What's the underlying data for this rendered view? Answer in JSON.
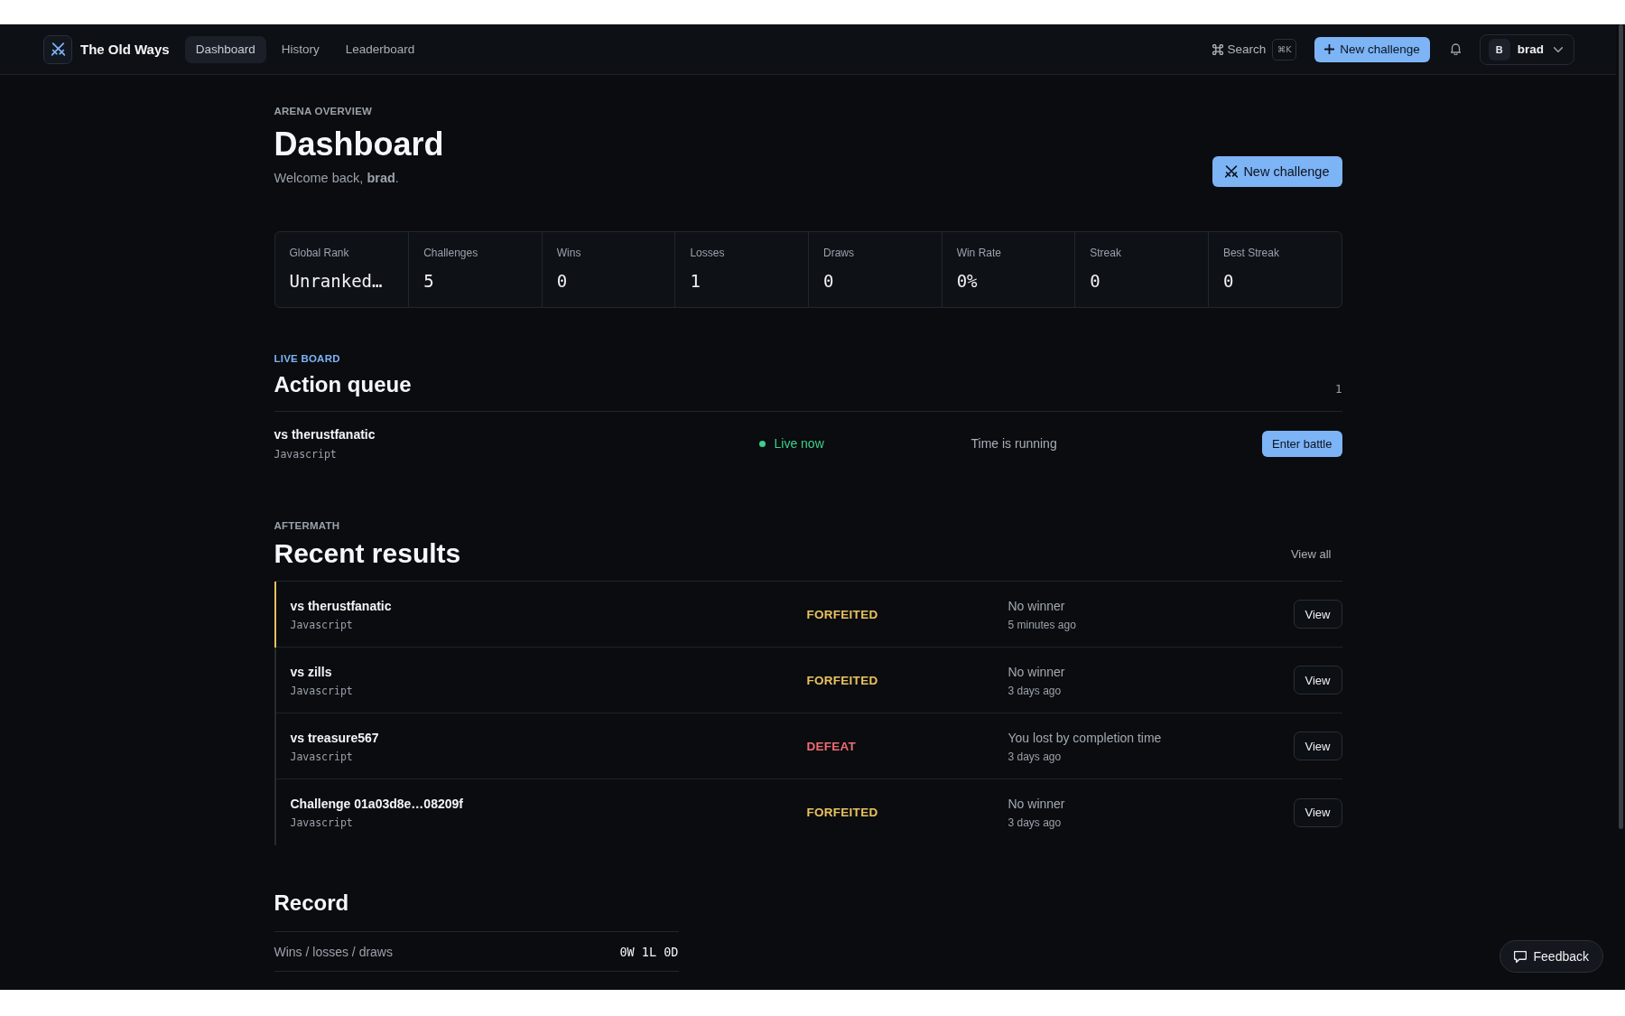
{
  "nav": {
    "brand": "The Old Ways",
    "tabs": [
      {
        "label": "Dashboard",
        "selected": true
      },
      {
        "label": "History",
        "selected": false
      },
      {
        "label": "Leaderboard",
        "selected": false
      }
    ],
    "search": {
      "label": "Search",
      "shortcut": "⌘K"
    },
    "new_challenge": "New challenge",
    "user": {
      "initial": "B",
      "name": "brad"
    }
  },
  "header": {
    "eyebrow": "ARENA OVERVIEW",
    "title": "Dashboard",
    "welcome": "Welcome back, **brad**.",
    "action": "New challenge"
  },
  "stats": [
    {
      "label": "Global Rank",
      "value": "Unranked…"
    },
    {
      "label": "Challenges",
      "value": "5"
    },
    {
      "label": "Wins",
      "value": "0"
    },
    {
      "label": "Losses",
      "value": "1"
    },
    {
      "label": "Draws",
      "value": "0"
    },
    {
      "label": "Win Rate",
      "value": "0%"
    },
    {
      "label": "Streak",
      "value": "0"
    },
    {
      "label": "Best Streak",
      "value": "0"
    }
  ],
  "action_queue": {
    "eyebrow": "LIVE BOARD",
    "title": "Action queue",
    "count": "1",
    "items": [
      {
        "title": "vs therustfanatic",
        "language": "Javascript",
        "status": "Live now",
        "live": true,
        "note": "Time is running",
        "action": "Enter battle"
      }
    ]
  },
  "recent_results": {
    "eyebrow": "AFTERMATH",
    "title": "Recent results",
    "view_all": "View all",
    "rows": [
      {
        "title": "vs therustfanatic",
        "language": "Javascript",
        "outcome": "FORFEITED",
        "color": "#e9c15f",
        "detail": "No winner",
        "time": "5 minutes ago",
        "action": "View",
        "highlighted": true
      },
      {
        "title": "vs zills",
        "language": "Javascript",
        "outcome": "FORFEITED",
        "color": "#e9c15f",
        "detail": "No winner",
        "time": "3 days ago",
        "action": "View",
        "highlighted": false
      },
      {
        "title": "vs treasure567",
        "language": "Javascript",
        "outcome": "DEFEAT",
        "color": "#ee6b73",
        "detail": "You lost by completion time",
        "time": "3 days ago",
        "action": "View",
        "highlighted": false
      },
      {
        "title": "Challenge 01a03d8e…08209f",
        "language": "Javascript",
        "outcome": "FORFEITED",
        "color": "#e9c15f",
        "detail": "No winner",
        "time": "3 days ago",
        "action": "View",
        "highlighted": false
      }
    ]
  },
  "record": {
    "title": "Record",
    "rows": [
      {
        "label": "Wins / losses / draws",
        "value": "0W 1L 0D"
      }
    ]
  },
  "feedback": "Feedback"
}
